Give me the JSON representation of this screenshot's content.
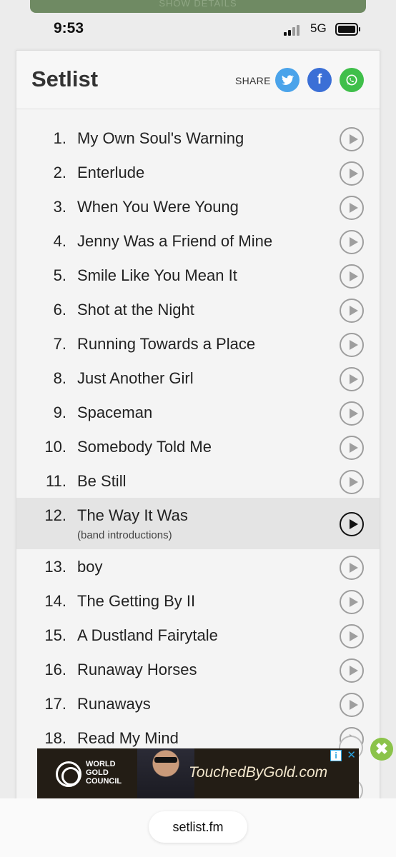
{
  "top_button": {
    "label": "SHOW DETAILS"
  },
  "status": {
    "time": "9:53",
    "network": "5G"
  },
  "header": {
    "title": "Setlist",
    "share_label": "SHARE"
  },
  "social": [
    {
      "name": "twitter",
      "icon": "twitter-icon",
      "color": "#4aa3ea"
    },
    {
      "name": "facebook",
      "icon": "facebook-icon",
      "color": "#3b6fd6",
      "glyph": "f"
    },
    {
      "name": "whatsapp",
      "icon": "whatsapp-icon",
      "color": "#3fbf4a"
    }
  ],
  "songs": [
    {
      "num": "1.",
      "title": "My Own Soul's Warning"
    },
    {
      "num": "2.",
      "title": "Enterlude"
    },
    {
      "num": "3.",
      "title": "When You Were Young"
    },
    {
      "num": "4.",
      "title": "Jenny Was a Friend of Mine"
    },
    {
      "num": "5.",
      "title": "Smile Like You Mean It"
    },
    {
      "num": "6.",
      "title": "Shot at the Night"
    },
    {
      "num": "7.",
      "title": "Running Towards a Place"
    },
    {
      "num": "8.",
      "title": "Just Another Girl"
    },
    {
      "num": "9.",
      "title": "Spaceman"
    },
    {
      "num": "10.",
      "title": "Somebody Told Me"
    },
    {
      "num": "11.",
      "title": "Be Still"
    },
    {
      "num": "12.",
      "title": "The Way It Was",
      "note": "(band introductions)",
      "highlight": true
    },
    {
      "num": "13.",
      "title": "boy"
    },
    {
      "num": "14.",
      "title": "The Getting By II"
    },
    {
      "num": "15.",
      "title": "A Dustland Fairytale"
    },
    {
      "num": "16.",
      "title": "Runaway Horses"
    },
    {
      "num": "17.",
      "title": "Runaways"
    },
    {
      "num": "18.",
      "title": "Read My Mind"
    }
  ],
  "ad": {
    "org_line1": "WORLD",
    "org_line2": "GOLD",
    "org_line3": "COUNCIL",
    "tagline": "TouchedByGold.com",
    "info_glyph": "i",
    "close_glyph": "✕"
  },
  "close_ad_glyph": "✖",
  "browser": {
    "url": "setlist.fm"
  }
}
